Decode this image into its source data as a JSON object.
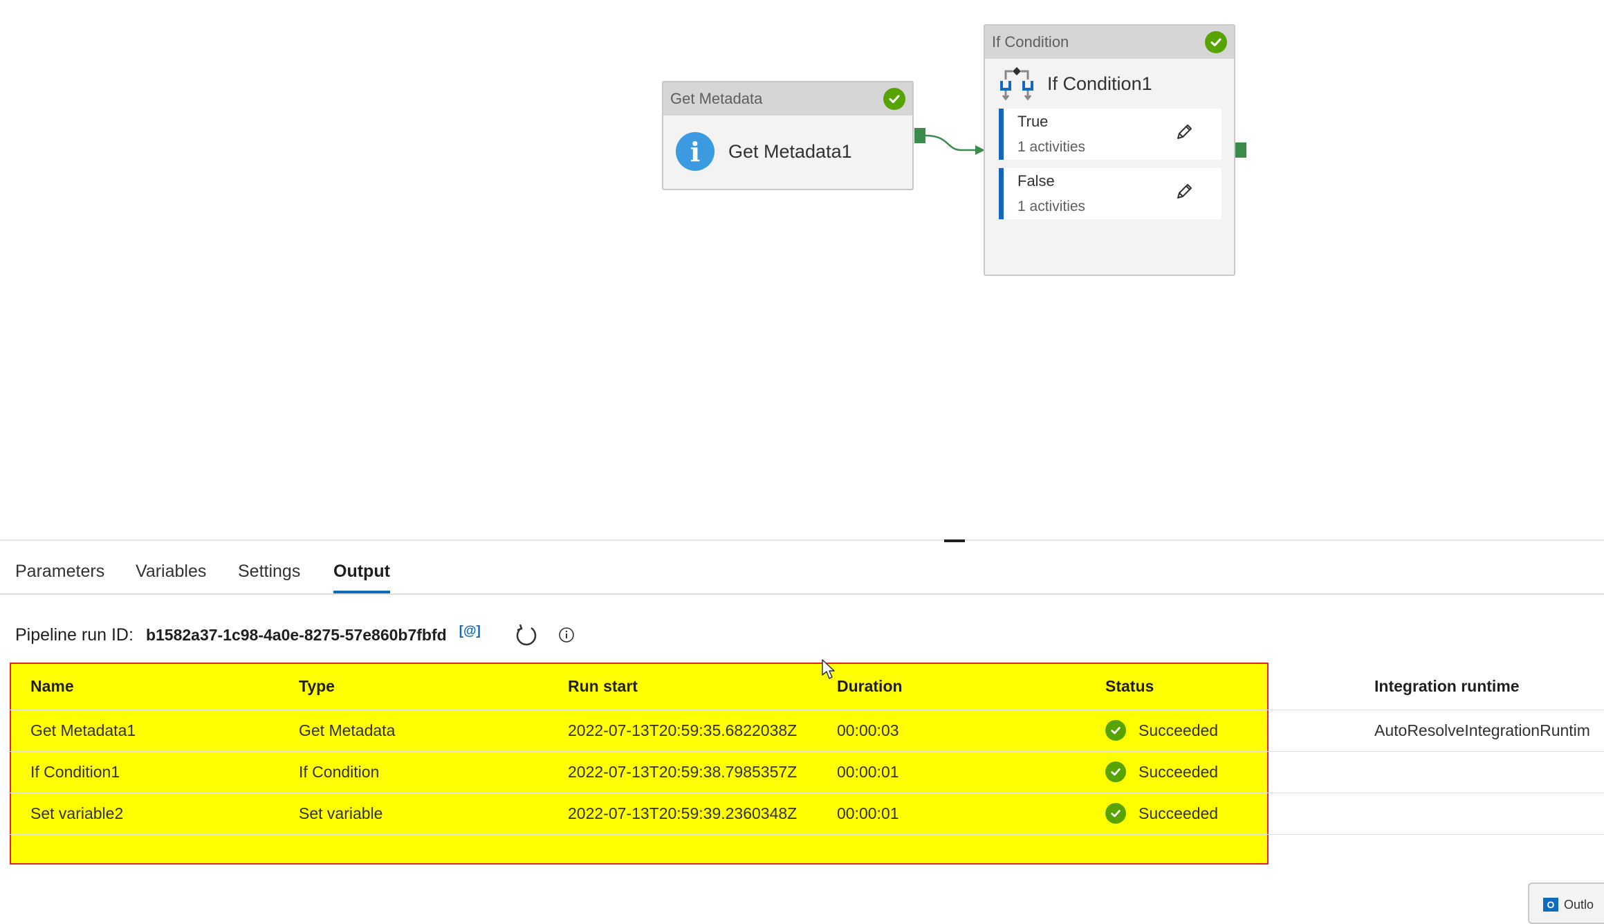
{
  "canvas": {
    "get_metadata": {
      "type_label": "Get Metadata",
      "name": "Get Metadata1",
      "status": "succeeded"
    },
    "if_condition": {
      "type_label": "If Condition",
      "name": "If Condition1",
      "status": "succeeded",
      "branches": [
        {
          "label": "True",
          "count": "1 activities"
        },
        {
          "label": "False",
          "count": "1 activities"
        }
      ]
    }
  },
  "tabs": [
    {
      "label": "Parameters",
      "active": false
    },
    {
      "label": "Variables",
      "active": false
    },
    {
      "label": "Settings",
      "active": false
    },
    {
      "label": "Output",
      "active": true
    }
  ],
  "run": {
    "label": "Pipeline run ID:",
    "id": "b1582a37-1c98-4a0e-8275-57e860b7fbfd",
    "copy_label": "[@]"
  },
  "table": {
    "columns": [
      "Name",
      "Type",
      "Run start",
      "Duration",
      "Status",
      "Integration runtime"
    ],
    "rows": [
      {
        "name": "Get Metadata1",
        "type": "Get Metadata",
        "run_start": "2022-07-13T20:59:35.6822038Z",
        "duration": "00:00:03",
        "status": "Succeeded",
        "runtime": "AutoResolveIntegrationRuntim"
      },
      {
        "name": "If Condition1",
        "type": "If Condition",
        "run_start": "2022-07-13T20:59:38.7985357Z",
        "duration": "00:00:01",
        "status": "Succeeded",
        "runtime": ""
      },
      {
        "name": "Set variable2",
        "type": "Set variable",
        "run_start": "2022-07-13T20:59:39.2360348Z",
        "duration": "00:00:01",
        "status": "Succeeded",
        "runtime": ""
      }
    ]
  },
  "taskbar": {
    "outlook_label": "Outlo"
  },
  "colors": {
    "success": "#57a300",
    "accent": "#0f6cbd",
    "highlight": "#ffff00",
    "highlight_border": "#e8232a"
  }
}
